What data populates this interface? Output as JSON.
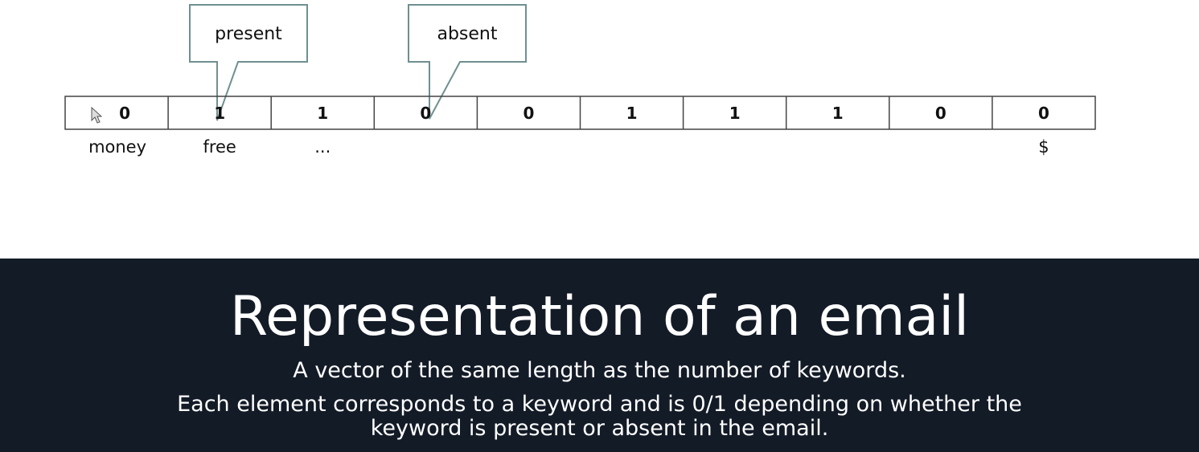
{
  "callouts": {
    "present": "present",
    "absent": "absent"
  },
  "vector": {
    "values": [
      "0",
      "1",
      "1",
      "0",
      "0",
      "1",
      "1",
      "1",
      "0",
      "0"
    ],
    "labels": [
      "money",
      "free",
      "...",
      "",
      "",
      "",
      "",
      "",
      "",
      "$"
    ]
  },
  "slide": {
    "title": "Representation of an email",
    "line1": "A vector of the same length as the number of keywords.",
    "line2a": "Each element corresponds to a keyword and is 0/1 depending on whether the",
    "line2b": "keyword is present or absent in the email."
  },
  "colors": {
    "footer_bg": "#131b27",
    "footer_text": "#ffffff",
    "callout_border": "#6f8f90"
  }
}
